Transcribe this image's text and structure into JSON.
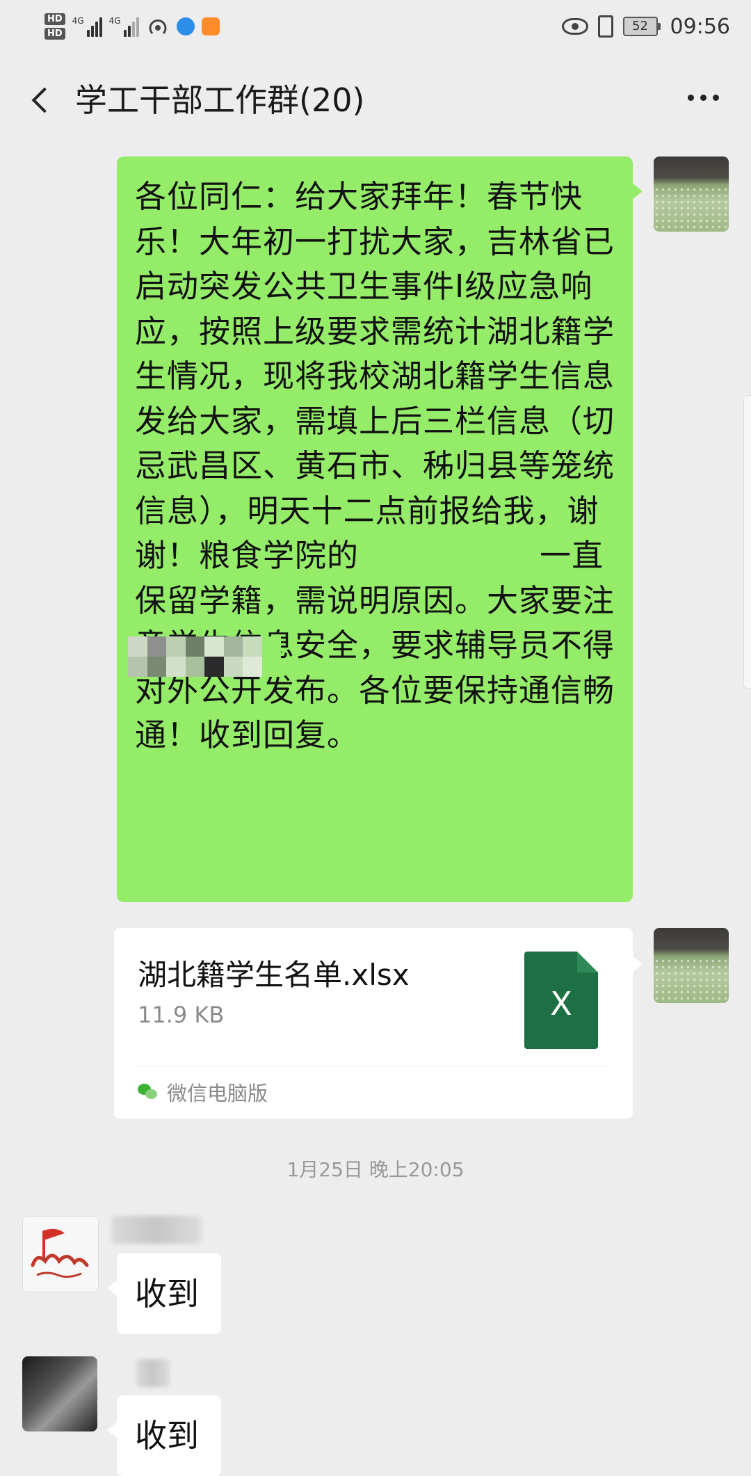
{
  "status_bar": {
    "hd1": "HD",
    "hd2": "HD",
    "sig1": "4G",
    "sig2": "4G",
    "battery": "52",
    "time": "09:56"
  },
  "header": {
    "title": "学工干部工作群(20)"
  },
  "messages": {
    "notice": "各位同仁：给大家拜年！春节快乐！大年初一打扰大家，吉林省已启动突发公共卫生事件Ⅰ级应急响应，按照上级要求需统计湖北籍学生情况，现将我校湖北籍学生信息发给大家，需填上后三栏信息（切忌武昌区、黄石市、秭归县等笼统信息），明天十二点前报给我，谢谢！粮食学院的                 一直保留学籍，需说明原因。大家要注意学生信息安全，要求辅导员不得对外公开发布。各位要保持通信畅通！收到回复。",
    "file": {
      "name": "湖北籍学生名单.xlsx",
      "size": "11.9 KB",
      "icon_letter": "X",
      "source": "微信电脑版"
    },
    "timestamp": "1月25日 晚上20:05",
    "reply1": "收到",
    "reply2": "收到"
  },
  "colors": {
    "bubble_green": "#95ec69",
    "background": "#ededed",
    "excel_green": "#1d7044"
  }
}
